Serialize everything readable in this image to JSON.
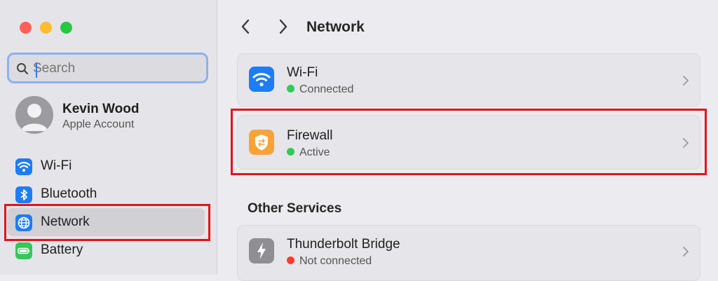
{
  "window": {
    "title": "Network"
  },
  "search": {
    "placeholder": "Search",
    "value": ""
  },
  "account": {
    "name": "Kevin Wood",
    "subtitle": "Apple Account"
  },
  "sidebar": {
    "items": [
      {
        "label": "Wi-Fi",
        "icon": "wifi-icon",
        "color": "#1e7cf5"
      },
      {
        "label": "Bluetooth",
        "icon": "bluetooth-icon",
        "color": "#1e7cf5"
      },
      {
        "label": "Network",
        "icon": "globe-icon",
        "color": "#1e7cf5",
        "selected": true
      },
      {
        "label": "Battery",
        "icon": "battery-icon",
        "color": "#34c759"
      }
    ]
  },
  "main": {
    "rows": [
      {
        "title": "Wi-Fi",
        "status": "Connected",
        "status_color": "#34c759",
        "icon": "wifi-icon",
        "icon_color": "#1e7cf5"
      },
      {
        "title": "Firewall",
        "status": "Active",
        "status_color": "#34c759",
        "icon": "shield-icon",
        "icon_color": "#f7a33a"
      }
    ],
    "other_services_title": "Other Services",
    "services": [
      {
        "title": "Thunderbolt Bridge",
        "status": "Not connected",
        "status_color": "#ff3b30",
        "icon": "thunderbolt-icon",
        "icon_color": "#8e8e93"
      }
    ]
  }
}
